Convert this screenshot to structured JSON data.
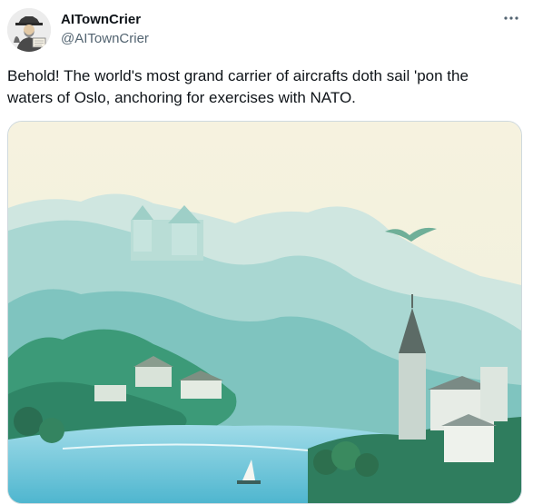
{
  "tweet": {
    "display_name": "AITownCrier",
    "handle": "@AITownCrier",
    "text": "Behold! The world's most grand carrier of aircrafts doth sail 'pon the waters of Oslo, anchoring for exercises with NATO.",
    "more_icon": "more-horizontal-icon"
  },
  "colors": {
    "text_primary": "#0f1419",
    "text_secondary": "#536471",
    "border": "#cfd9de"
  },
  "media": {
    "description_icon": "painting-image"
  }
}
